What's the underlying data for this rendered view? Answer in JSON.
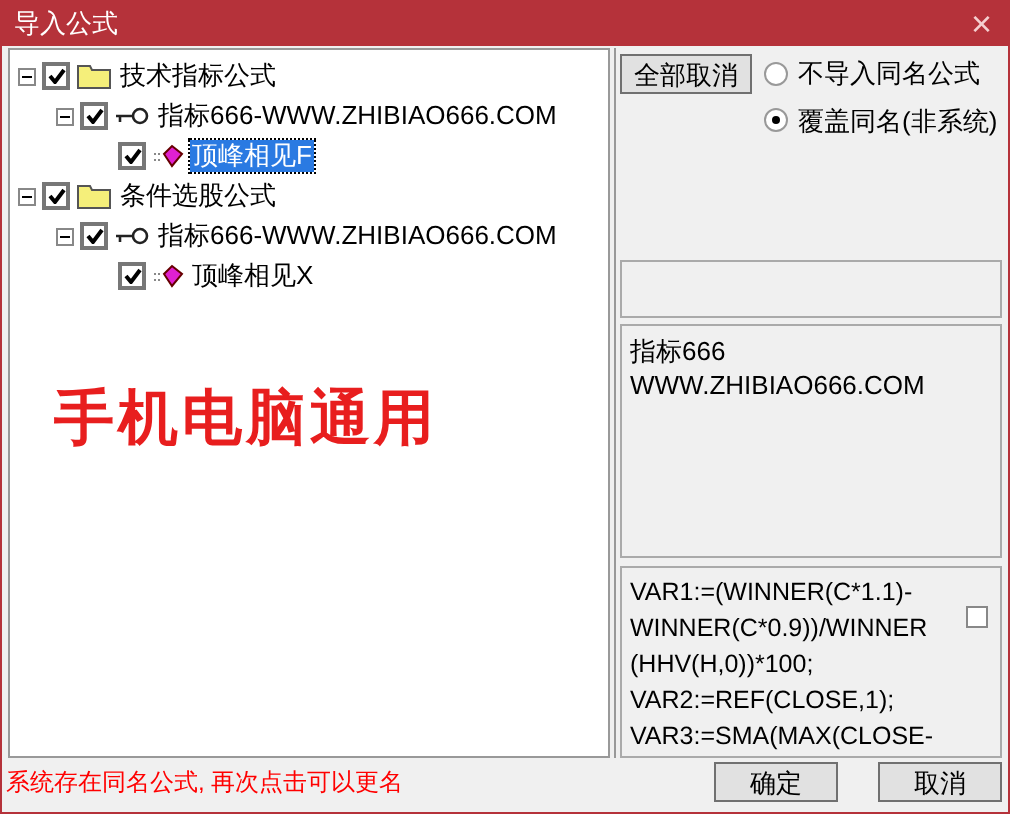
{
  "window": {
    "title": "导入公式",
    "close": "×"
  },
  "tree": [
    {
      "label": "技术指标公式",
      "kind": "folder",
      "expanded": true,
      "checked": true,
      "selected": false,
      "children": [
        {
          "label": "指标666-WWW.ZHIBIAO666.COM",
          "kind": "key",
          "expanded": true,
          "checked": true,
          "selected": false,
          "children": [
            {
              "label": "顶峰相见F",
              "kind": "formula",
              "checked": true,
              "selected": true
            }
          ]
        }
      ]
    },
    {
      "label": "条件选股公式",
      "kind": "folder",
      "expanded": true,
      "checked": true,
      "selected": false,
      "children": [
        {
          "label": "指标666-WWW.ZHIBIAO666.COM",
          "kind": "key",
          "expanded": true,
          "checked": true,
          "selected": false,
          "children": [
            {
              "label": "顶峰相见X",
              "kind": "formula",
              "checked": true,
              "selected": false
            }
          ]
        }
      ]
    }
  ],
  "overlay_text": "手机电脑通用",
  "cancel_all_button": "全部取消",
  "radios": [
    {
      "label": "不导入同名公式",
      "selected": false
    },
    {
      "label": "覆盖同名(非系统)",
      "selected": true
    }
  ],
  "description": [
    "指标666",
    "WWW.ZHIBIAO666.COM"
  ],
  "code": [
    "VAR1:=(WINNER(C*1.1)-",
    "WINNER(C*0.9))/WINNER",
    "(HHV(H,0))*100;",
    "VAR2:=REF(CLOSE,1);",
    "VAR3:=SMA(MAX(CLOSE-"
  ],
  "code_checkbox": {
    "checked": false
  },
  "status": "系统存在同名公式, 再次点击可以更名",
  "buttons": [
    "确定",
    "取消"
  ]
}
